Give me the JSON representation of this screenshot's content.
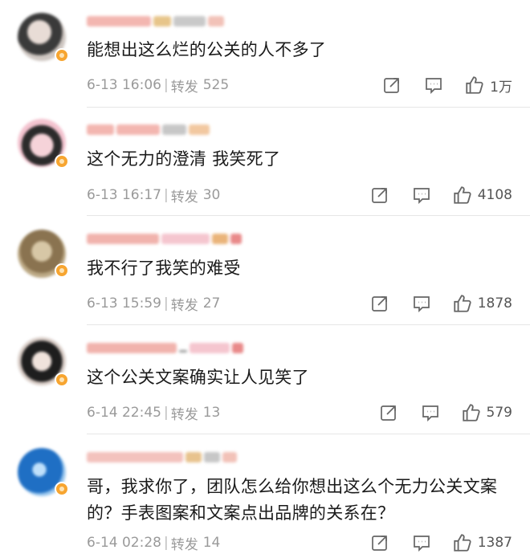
{
  "comments": [
    {
      "text": "能想出这么烂的公关的人不多了",
      "date": "6-13 16:06",
      "repost_label": "转发",
      "repost_count": "525",
      "likes": "1万",
      "avatar_colors": [
        "#3a3a3a",
        "#d8d0cc"
      ]
    },
    {
      "text": "这个无力的澄清 我笑死了",
      "date": "6-13 16:17",
      "repost_label": "转发",
      "repost_count": "30",
      "likes": "4108",
      "avatar_colors": [
        "#2b2b2b",
        "#f3c3cf"
      ]
    },
    {
      "text": "我不行了我笑的难受",
      "date": "6-13 15:59",
      "repost_label": "转发",
      "repost_count": "27",
      "likes": "1878",
      "avatar_colors": [
        "#8a7350",
        "#d7c7a6"
      ]
    },
    {
      "text": "这个公关文案确实让人见笑了",
      "date": "6-14 22:45",
      "repost_label": "转发",
      "repost_count": "13",
      "likes": "579",
      "avatar_colors": [
        "#1e1e1e",
        "#e6d9d2"
      ]
    },
    {
      "text": "哥，我求你了，团队怎么给你想出这么个无力公关文案的？手表图案和文案点出品牌的关系在？",
      "date": "6-14 02:28",
      "repost_label": "转发",
      "repost_count": "14",
      "likes": "1387",
      "avatar_colors": [
        "#1f6fc4",
        "#9cc8ee"
      ]
    }
  ],
  "colors": {
    "accent_badge": "#f7a530",
    "nickname_blur": "#f0b0a8",
    "meta_text": "#9a9a9a",
    "icon": "#666666"
  },
  "icons": [
    "share-icon",
    "comment-icon",
    "like-icon",
    "vip-badge-icon"
  ]
}
